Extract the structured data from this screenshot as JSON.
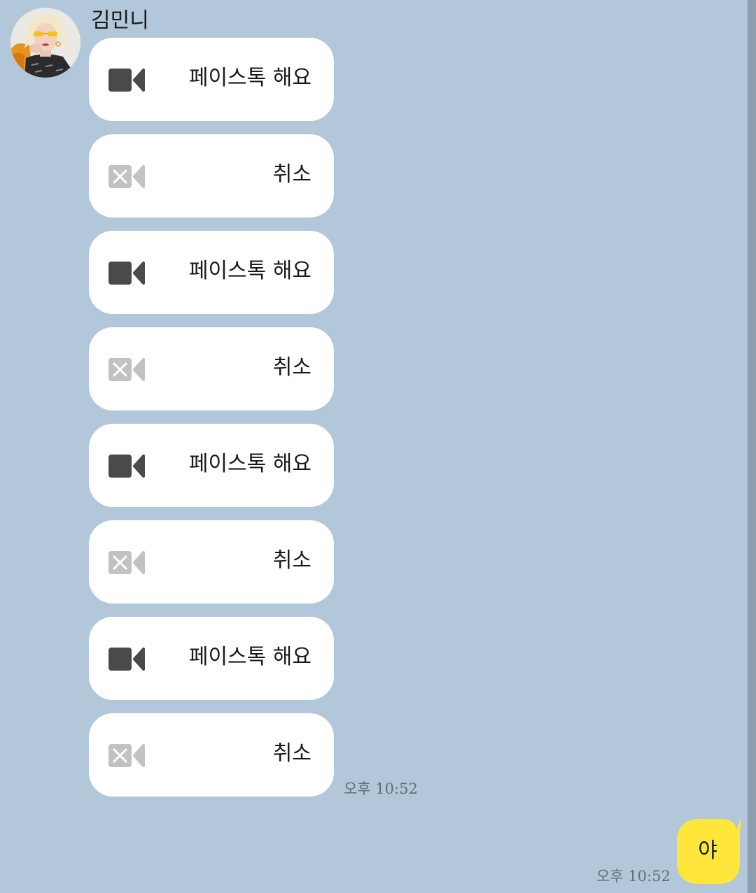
{
  "chat": {
    "sender_name": "김민니",
    "messages": [
      {
        "kind": "call",
        "label": "페이스톡 해요"
      },
      {
        "kind": "cancel",
        "label": "취소"
      },
      {
        "kind": "call",
        "label": "페이스톡 해요"
      },
      {
        "kind": "cancel",
        "label": "취소"
      },
      {
        "kind": "call",
        "label": "페이스톡 해요"
      },
      {
        "kind": "cancel",
        "label": "취소"
      },
      {
        "kind": "call",
        "label": "페이스톡 해요"
      },
      {
        "kind": "cancel",
        "label": "취소"
      }
    ],
    "received_time": "오후 10:52",
    "my_message": {
      "text": "야",
      "time": "오후 10:52"
    }
  },
  "icons": {
    "avatar": "profile-photo",
    "call": "video-camera-icon",
    "cancel": "video-camera-cancelled-icon"
  },
  "colors": {
    "background": "#b2c7da",
    "bubble": "#ffffff",
    "my_bubble": "#fee73a",
    "camera_active": "#4a4a4a",
    "camera_cancelled": "#c2c2c2",
    "timestamp": "#646d75"
  }
}
